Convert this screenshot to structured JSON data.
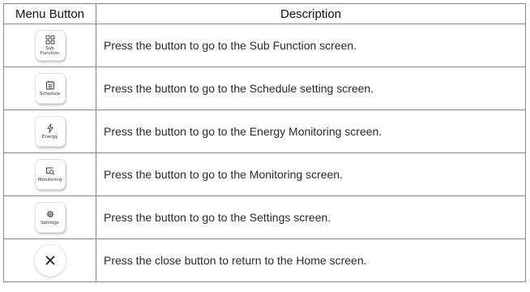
{
  "table": {
    "headers": {
      "menu_button": "Menu Button",
      "description": "Description"
    },
    "rows": [
      {
        "button_label": "Sub\nFunction",
        "icon": "grid-icon",
        "description": "Press the button to go to the Sub Function screen."
      },
      {
        "button_label": "Schedule",
        "icon": "calendar-icon",
        "description": "Press the button to go to the Schedule setting screen."
      },
      {
        "button_label": "Energy",
        "icon": "lightning-icon",
        "description": "Press the button to go to the Energy Monitoring screen."
      },
      {
        "button_label": "Monitoring",
        "icon": "monitor-search-icon",
        "description": "Press the button to go to the Monitoring screen."
      },
      {
        "button_label": "Settings",
        "icon": "gear-icon",
        "description": "Press the button to go to the Settings screen."
      },
      {
        "button_label": "",
        "icon": "close-icon",
        "description": "Press the close button to return to the Home screen."
      }
    ]
  }
}
